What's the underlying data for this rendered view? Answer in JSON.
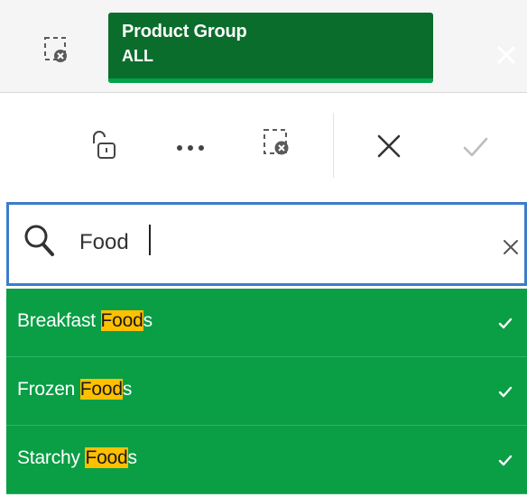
{
  "selection_bar": {
    "clear_all_icon": "clear-selections-icon",
    "chip": {
      "title": "Product Group",
      "value": "ALL",
      "close_icon": "close-icon",
      "color": "#0a6d2b",
      "accent": "#00a349"
    }
  },
  "toolbar": {
    "items": [
      {
        "name": "lock",
        "icon": "unlock-icon"
      },
      {
        "name": "more",
        "icon": "more-horizontal-icon"
      },
      {
        "name": "clear-selections",
        "icon": "clear-selections-icon"
      },
      {
        "name": "cancel",
        "icon": "close-icon"
      },
      {
        "name": "confirm",
        "icon": "check-icon"
      }
    ]
  },
  "search": {
    "value": "Food",
    "placeholder": "",
    "icon": "search-icon",
    "clear_icon": "clear-icon",
    "border_color": "#3d7cc9"
  },
  "results": {
    "selected_color": "#0a9e45",
    "highlight_color": "#ffc000",
    "items": [
      {
        "prefix": "Breakfast ",
        "match": "Food",
        "suffix": "s",
        "selected": true
      },
      {
        "prefix": "Frozen ",
        "match": "Food",
        "suffix": "s",
        "selected": true
      },
      {
        "prefix": "Starchy ",
        "match": "Food",
        "suffix": "s",
        "selected": true
      }
    ]
  }
}
